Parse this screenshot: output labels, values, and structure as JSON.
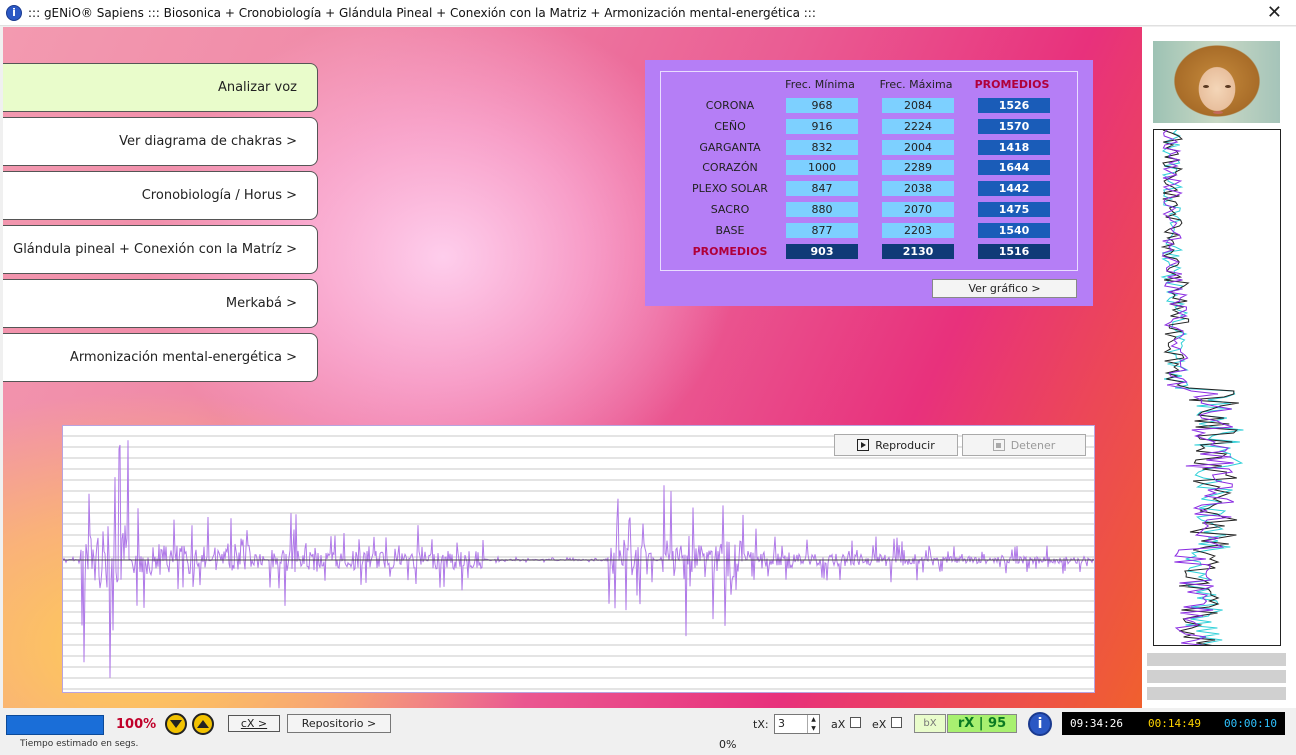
{
  "window": {
    "title": "::: gENiO® Sapiens ::: Biosonica + Cronobiología + Glándula Pineal + Conexión con la Matriz + Armonización mental-energética :::",
    "close_glyph": "✕",
    "app_icon_glyph": "i"
  },
  "menu": {
    "items": [
      {
        "label": "Analizar voz",
        "active": true
      },
      {
        "label": "Ver diagrama de chakras >"
      },
      {
        "label": "Cronobiología / Horus >"
      },
      {
        "label": "Glándula pineal + Conexión con la Matríz >"
      },
      {
        "label": "Merkabá >"
      },
      {
        "label": "Armonización mental-energética >"
      }
    ]
  },
  "stats": {
    "headers": {
      "min": "Frec. Mínima",
      "max": "Frec. Máxima",
      "avg": "PROMEDIOS"
    },
    "rows": [
      {
        "label": "CORONA",
        "min": "968",
        "max": "2084",
        "avg": "1526"
      },
      {
        "label": "CEÑO",
        "min": "916",
        "max": "2224",
        "avg": "1570"
      },
      {
        "label": "GARGANTA",
        "min": "832",
        "max": "2004",
        "avg": "1418"
      },
      {
        "label": "CORAZÓN",
        "min": "1000",
        "max": "2289",
        "avg": "1644"
      },
      {
        "label": "PLEXO SOLAR",
        "min": "847",
        "max": "2038",
        "avg": "1442"
      },
      {
        "label": "SACRO",
        "min": "880",
        "max": "2070",
        "avg": "1475"
      },
      {
        "label": "BASE",
        "min": "877",
        "max": "2203",
        "avg": "1540"
      }
    ],
    "totals": {
      "label": "PROMEDIOS",
      "min": "903",
      "max": "2130",
      "avg": "1516"
    },
    "graph_button": "Ver gráfico >"
  },
  "waveform": {
    "play_label": "Reproducir",
    "stop_label": "Detener",
    "wave_color": "#b07ae8"
  },
  "status": {
    "progress_pct": "100%",
    "cx_label": "cX >",
    "repo_label": "Repositorio >",
    "tiempo_label": "Tiempo estimado en segs.",
    "bottom_pct": "0%",
    "tx_label": "tX:",
    "tx_value": "3",
    "ax_label": "aX",
    "ex_label": "eX",
    "bx_label": "bX",
    "rx_label": "rX | 95",
    "info_glyph": "i",
    "clock": {
      "t1": "09:34:26",
      "t2": "00:14:49",
      "t3": "00:00:10"
    }
  }
}
